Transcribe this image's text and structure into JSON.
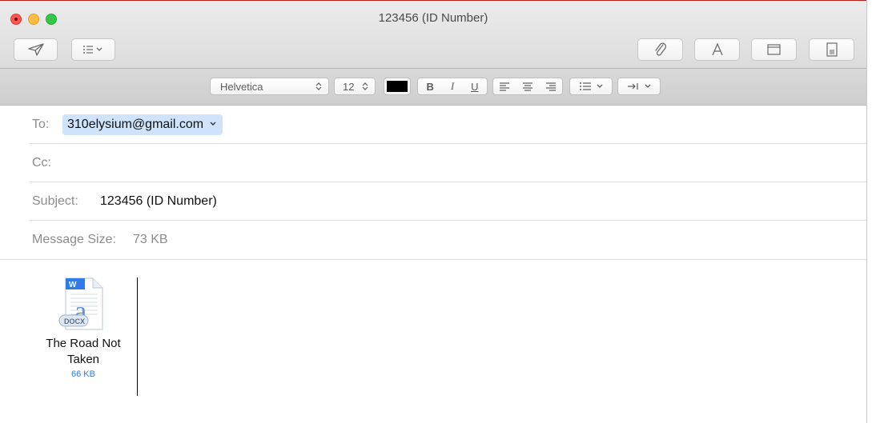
{
  "window": {
    "title": "123456 (ID Number)"
  },
  "format": {
    "font_family": "Helvetica",
    "font_size": "12",
    "text_color": "#000000"
  },
  "fields": {
    "to_label": "To:",
    "to_value": "310elysium@gmail.com",
    "cc_label": "Cc:",
    "subject_label": "Subject:",
    "subject_value": "123456 (ID Number)",
    "size_label": "Message Size:",
    "size_value": "73 KB"
  },
  "attachment": {
    "name": "The Road Not Taken",
    "size": "66 KB",
    "badge": "DOCX",
    "letter": "a",
    "app_letter": "W"
  },
  "colors": {
    "accent": "#2f7bea",
    "recipient_bg": "#cfe3fb",
    "close": "#fc5753",
    "minimize": "#fdbc40",
    "maximize": "#33c748"
  }
}
